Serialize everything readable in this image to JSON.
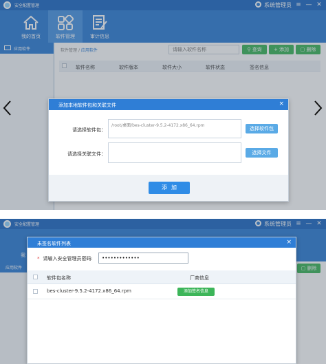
{
  "app": {
    "title": "安全配置管理",
    "user_label": "系统管理员",
    "menu_glyph": "≡",
    "minimize_glyph": "—",
    "close_glyph": "✕"
  },
  "nav": {
    "items": [
      {
        "label": "我的首页",
        "icon": "home-icon"
      },
      {
        "label": "软件管理",
        "icon": "apps-grid-icon"
      },
      {
        "label": "审计信息",
        "icon": "audit-doc-icon"
      }
    ],
    "active_index": 1
  },
  "sidebar": {
    "items": [
      {
        "label": "应用软件",
        "icon": "monitor-icon"
      }
    ]
  },
  "breadcrumb": {
    "parent": "软件管理",
    "separator": "/",
    "current": "应用软件"
  },
  "toolbar": {
    "search_placeholder": "请输入软件名称",
    "search_label": "查询",
    "add_label": "添加",
    "delete_label": "删除"
  },
  "table": {
    "columns": [
      "软件名称",
      "软件版本",
      "软件大小",
      "软件状态",
      "签名信息"
    ]
  },
  "navigation_arrows": {
    "prev": "previous-arrow-icon",
    "next": "next-arrow-icon"
  },
  "add_dialog": {
    "title": "添加本地软件包和关联文件",
    "close_glyph": "×",
    "package_label": "请选择软件包：",
    "package_value": "/root/桌面/bes-cluster-9.5.2-4172.x86_64.rpm",
    "package_button": "选择软件包",
    "file_label": "请选择关联文件：",
    "file_value": "",
    "file_button": "选择文件",
    "submit_label": "添加"
  },
  "unsigned_dialog": {
    "title": "未签名软件列表",
    "close_glyph": "×",
    "password_label": "请输入安全管理员密码:",
    "required_mark": "*",
    "password_value": "•••••••••••••",
    "columns": [
      "软件包名称",
      "厂商信息"
    ],
    "rows": [
      {
        "name": "bes-cluster-9.5.2-4172.x86_64.rpm",
        "action": "添加签名信息"
      }
    ]
  },
  "background_window": {
    "sidebar_label": "应用软件",
    "delete_label": "删除",
    "nav_partial": "我"
  },
  "colors": {
    "header_blue": "#2f7ed6",
    "accent_green": "#3cb559",
    "button_blue": "#5aaae6"
  }
}
